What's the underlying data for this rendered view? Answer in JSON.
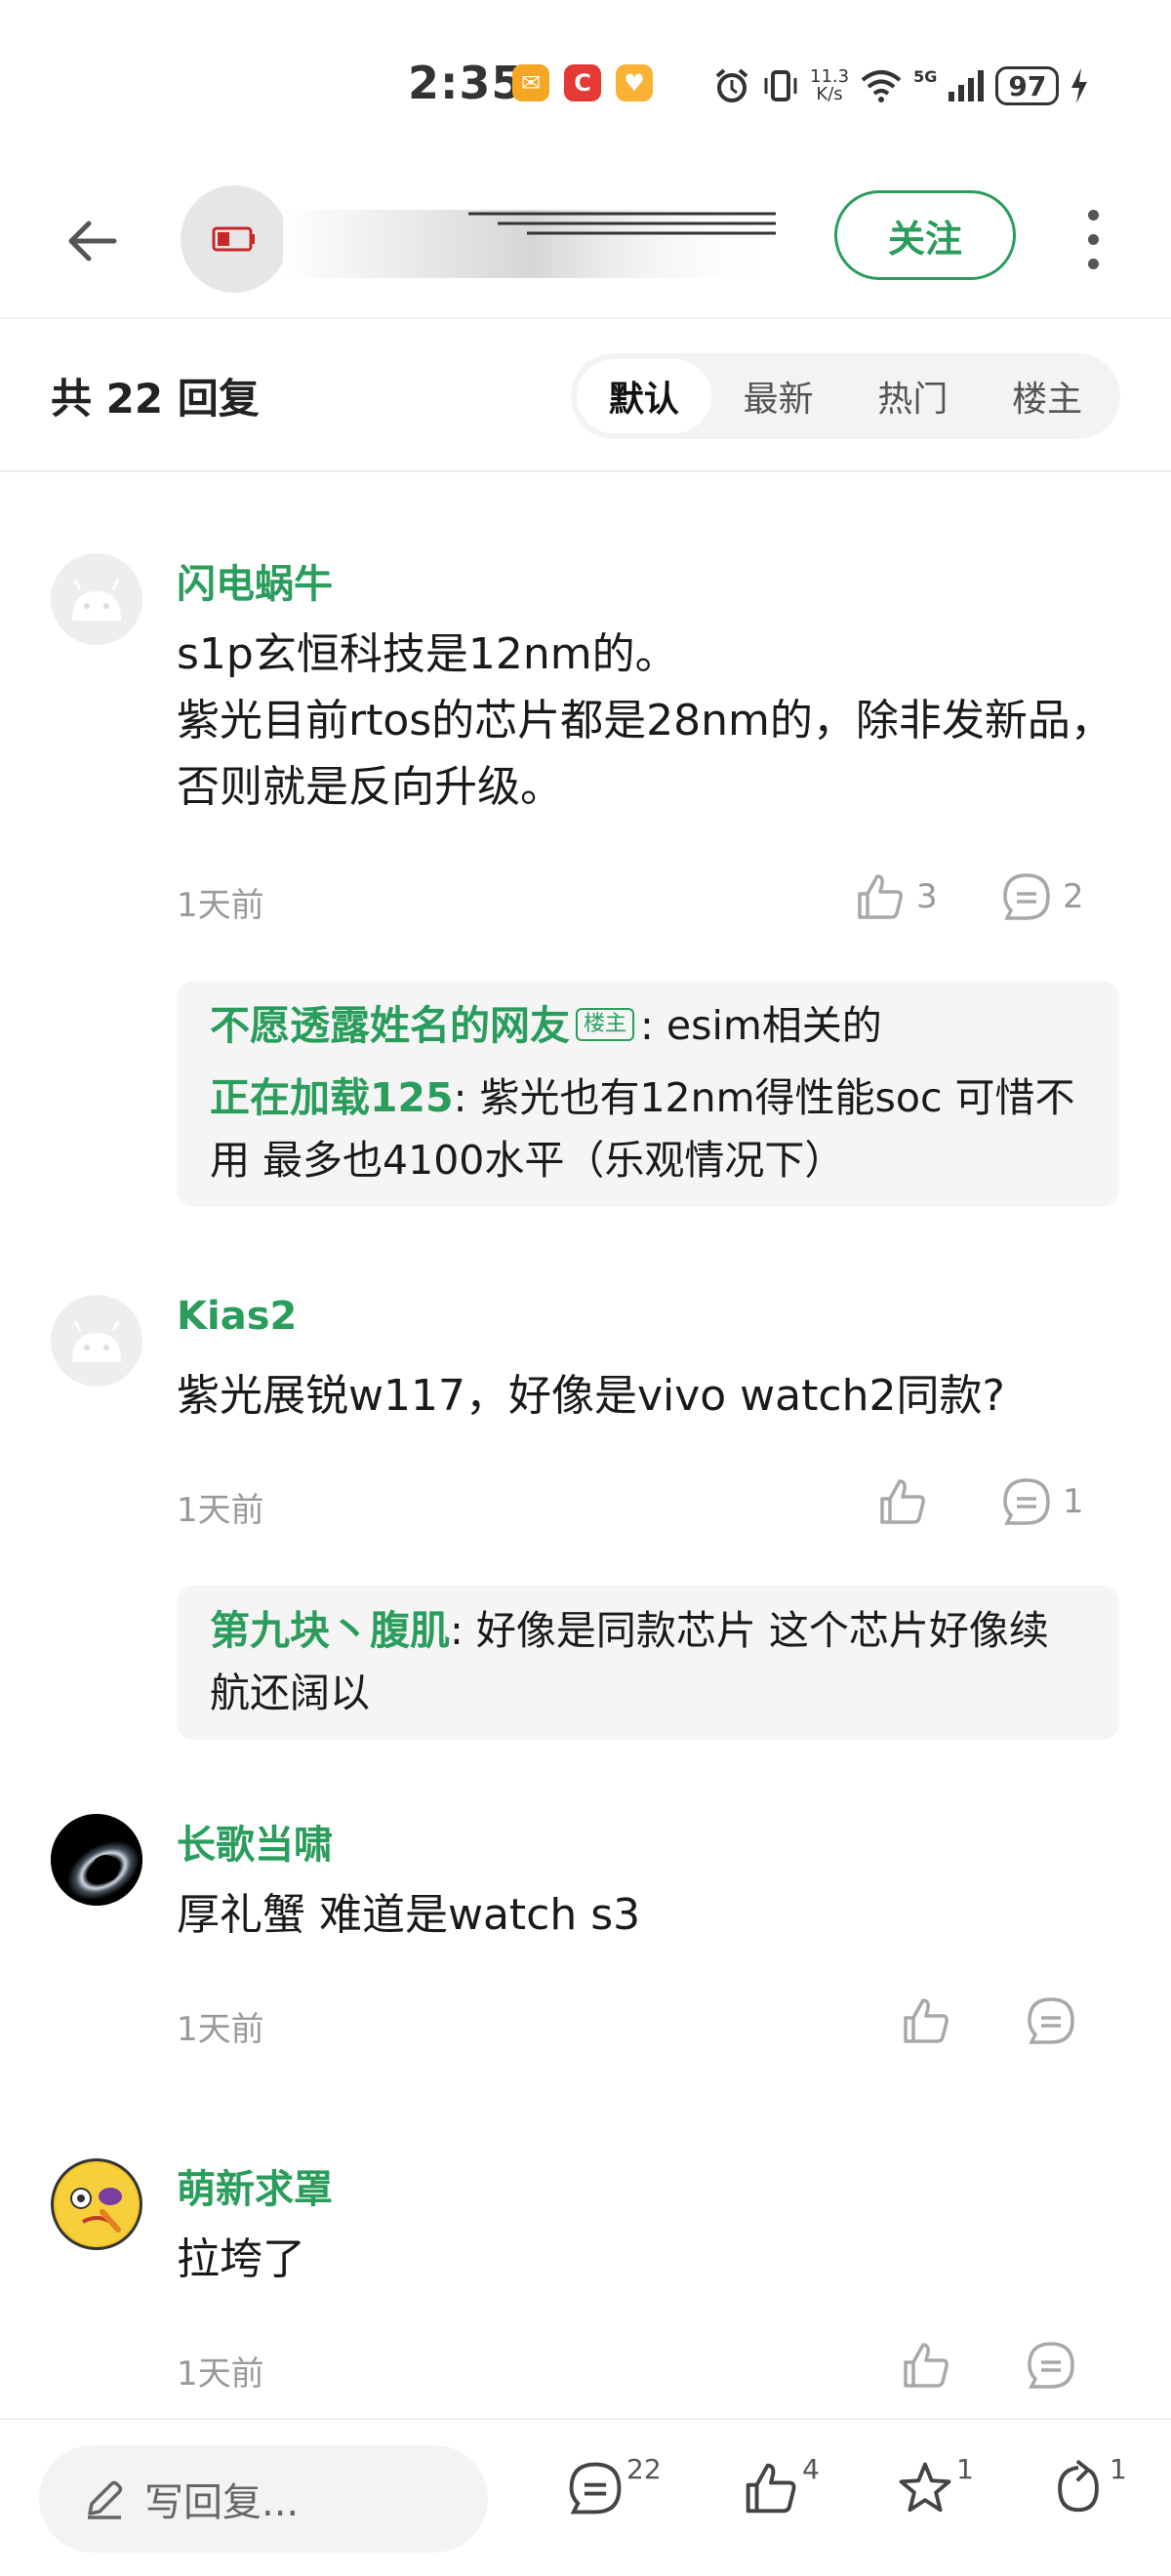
{
  "status_bar": {
    "time": "2:35",
    "net_speed_value": "11.3",
    "net_speed_unit": "K/s",
    "network": "5G",
    "battery": "97"
  },
  "header": {
    "follow_label": "关注"
  },
  "replies": {
    "count_label": "共 22 回复",
    "sort_tabs": [
      "默认",
      "最新",
      "热门",
      "楼主"
    ],
    "active_tab": "默认"
  },
  "comments": [
    {
      "author": "闪电蜗牛",
      "lines": [
        "s1p玄恒科技是12nm的。",
        "紫光目前rtos的芯片都是28nm的，除非发新品，否则就是反向升级。"
      ],
      "time": "1天前",
      "likes": "3",
      "replies": "2",
      "sub_replies": [
        {
          "name": "不愿透露姓名的网友",
          "badge": "楼主",
          "text": ": esim相关的"
        },
        {
          "name": "正在加载125",
          "text": ": 紫光也有12nm得性能soc 可惜不用 最多也4100水平（乐观情况下）"
        }
      ]
    },
    {
      "author": "Kias2",
      "lines": [
        "紫光展锐w117，好像是vivo watch2同款?"
      ],
      "time": "1天前",
      "likes": "",
      "replies": "1",
      "sub_replies": [
        {
          "name": "第九块丶腹肌",
          "text": ": 好像是同款芯片 这个芯片好像续航还阔以"
        }
      ]
    },
    {
      "author": "长歌当啸",
      "lines": [
        "厚礼蟹 难道是watch s3"
      ],
      "time": "1天前",
      "likes": "",
      "replies": ""
    },
    {
      "author": "萌新求罩",
      "lines": [
        "拉垮了"
      ],
      "time": "1天前",
      "likes": "",
      "replies": ""
    }
  ],
  "bottom_bar": {
    "write_placeholder": "写回复...",
    "comments_count": "22",
    "likes_count": "4",
    "favorites_count": "1",
    "shares_count": "1"
  },
  "colors": {
    "accent_green": "#2a9d5c",
    "muted_gray": "#9a9a9a"
  },
  "icons": [
    "back-arrow-icon",
    "more-vertical-icon",
    "thumb-up-icon",
    "comment-bubble-icon",
    "pencil-icon",
    "star-icon",
    "share-icon",
    "alarm-icon",
    "vibrate-icon",
    "wifi-icon",
    "signal-icon",
    "charging-icon"
  ]
}
